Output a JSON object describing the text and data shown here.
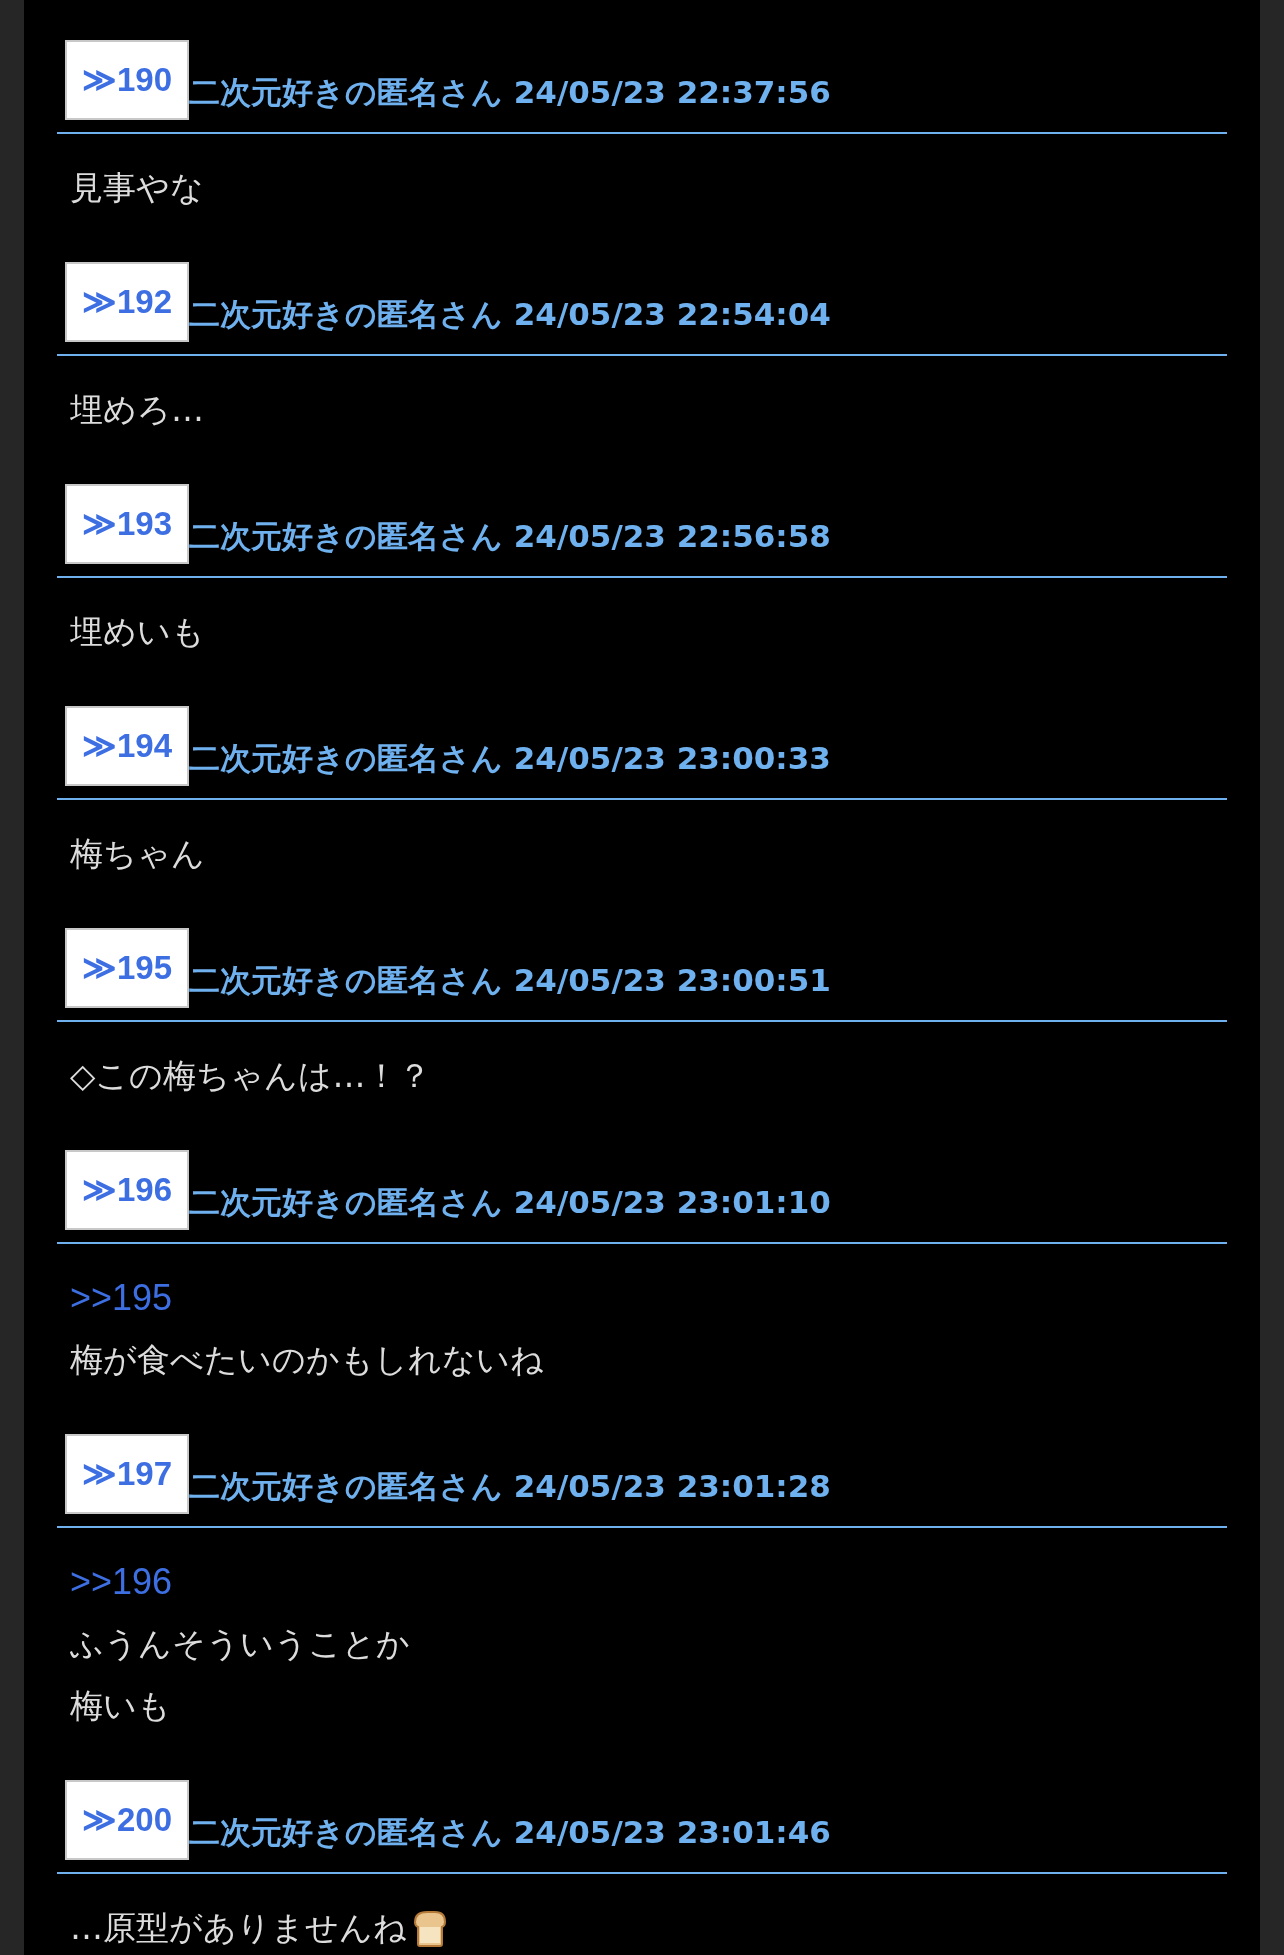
{
  "posts": [
    {
      "number": "≫190",
      "header": "二次元好きの匿名さん 24/05/23 22:37:56",
      "lines": [
        {
          "kind": "text",
          "text": "見事やな"
        }
      ]
    },
    {
      "number": "≫192",
      "header": "二次元好きの匿名さん 24/05/23 22:54:04",
      "lines": [
        {
          "kind": "text",
          "text": "埋めろ…"
        }
      ]
    },
    {
      "number": "≫193",
      "header": "二次元好きの匿名さん 24/05/23 22:56:58",
      "lines": [
        {
          "kind": "text",
          "text": "埋めいも"
        }
      ]
    },
    {
      "number": "≫194",
      "header": "二次元好きの匿名さん 24/05/23 23:00:33",
      "lines": [
        {
          "kind": "text",
          "text": "梅ちゃん"
        }
      ]
    },
    {
      "number": "≫195",
      "header": "二次元好きの匿名さん 24/05/23 23:00:51",
      "lines": [
        {
          "kind": "text",
          "text": "◇この梅ちゃんは…！？"
        }
      ]
    },
    {
      "number": "≫196",
      "header": "二次元好きの匿名さん 24/05/23 23:01:10",
      "lines": [
        {
          "kind": "reply_link",
          "text": ">>195"
        },
        {
          "kind": "text",
          "text": "梅が食べたいのかもしれないね"
        }
      ]
    },
    {
      "number": "≫197",
      "header": "二次元好きの匿名さん 24/05/23 23:01:28",
      "lines": [
        {
          "kind": "reply_link",
          "text": ">>196"
        },
        {
          "kind": "text",
          "text": "ふうんそういうことか"
        },
        {
          "kind": "text",
          "text": "梅いも"
        }
      ]
    },
    {
      "number": "≫200",
      "header": "二次元好きの匿名さん 24/05/23 23:01:46",
      "lines": [
        {
          "kind": "text_with_bread",
          "text": "…原型がありませんね"
        }
      ]
    }
  ]
}
